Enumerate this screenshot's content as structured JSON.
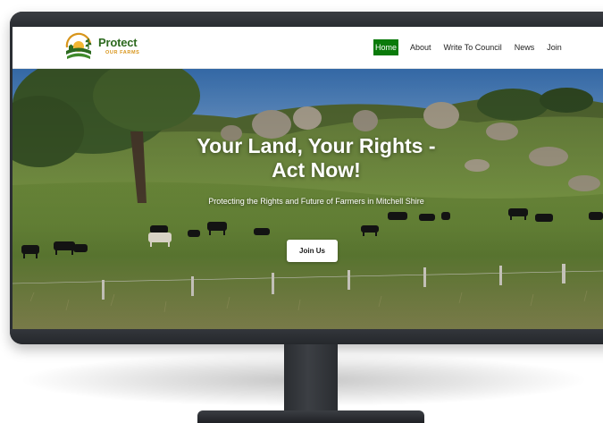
{
  "brand": {
    "name": "Protect",
    "tagline": "OUR FARMS",
    "colors": {
      "green": "#2d6a1f",
      "gold": "#d8951b"
    }
  },
  "nav": {
    "items": [
      {
        "label": "Home",
        "active": true
      },
      {
        "label": "About",
        "active": false
      },
      {
        "label": "Write To Council",
        "active": false
      },
      {
        "label": "News",
        "active": false
      },
      {
        "label": "Join",
        "active": false
      }
    ],
    "active_color": "#0a7a0a"
  },
  "hero": {
    "title_line1": "Your Land, Your Rights -",
    "title_line2": "Act Now!",
    "subtitle": "Protecting the Rights and Future of Farmers in Mitchell Shire",
    "cta_label": "Join Us",
    "background": "pasture with grazing cattle"
  },
  "device": {
    "type": "desktop monitor"
  }
}
